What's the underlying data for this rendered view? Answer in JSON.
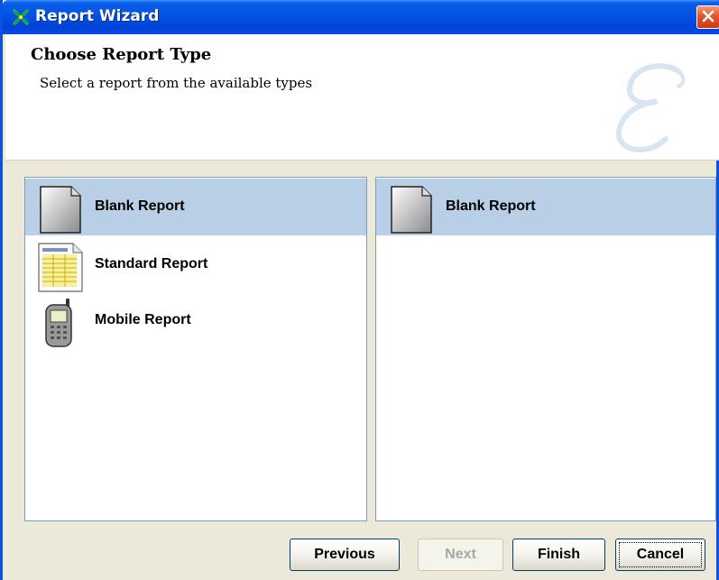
{
  "window": {
    "title": "Report Wizard",
    "title_icon": "wizard-icon",
    "close_icon": "close-icon"
  },
  "header": {
    "title": "Choose Report Type",
    "subtitle": "Select a report from the available types",
    "watermark_icon": "script-e-watermark"
  },
  "left_list": {
    "items": [
      {
        "label": "Blank Report",
        "icon": "blank-report-icon",
        "selected": true
      },
      {
        "label": "Standard Report",
        "icon": "standard-report-icon",
        "selected": false
      },
      {
        "label": "Mobile Report",
        "icon": "mobile-report-icon",
        "selected": false
      }
    ]
  },
  "right_list": {
    "items": [
      {
        "label": "Blank Report",
        "icon": "blank-report-icon",
        "selected": true
      }
    ]
  },
  "buttons": {
    "previous": "Previous",
    "next": "Next",
    "finish": "Finish",
    "cancel": "Cancel"
  },
  "colors": {
    "title_bar": "#0353e3",
    "selection": "#b8cfe5",
    "list_border": "#7f9db9",
    "dialog_bg": "#ece9d8"
  }
}
